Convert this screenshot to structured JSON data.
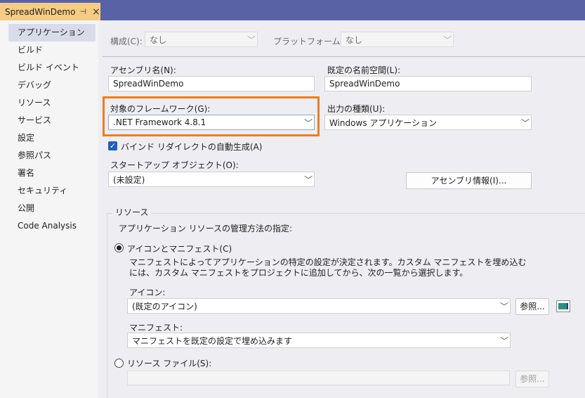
{
  "tab": {
    "title": "SpreadWinDemo",
    "pin": "⊣",
    "close": "×"
  },
  "sidebar": {
    "items": [
      {
        "label": "アプリケーション"
      },
      {
        "label": "ビルド"
      },
      {
        "label": "ビルド イベント"
      },
      {
        "label": "デバッグ"
      },
      {
        "label": "リソース"
      },
      {
        "label": "サービス"
      },
      {
        "label": "設定"
      },
      {
        "label": "参照パス"
      },
      {
        "label": "署名"
      },
      {
        "label": "セキュリティ"
      },
      {
        "label": "公開"
      },
      {
        "label": "Code Analysis"
      }
    ]
  },
  "config": {
    "label": "構成(C):",
    "value": "なし",
    "platform_label": "プラットフォーム(M):",
    "platform_value": "なし"
  },
  "assembly": {
    "label": "アセンブリ名(N):",
    "value": "SpreadWinDemo"
  },
  "namespace": {
    "label": "既定の名前空間(L):",
    "value": "SpreadWinDemo"
  },
  "framework": {
    "label": "対象のフレームワーク(G):",
    "value": ".NET Framework 4.8.1"
  },
  "output": {
    "label": "出力の種類(U):",
    "value": "Windows アプリケーション"
  },
  "binding": {
    "check": "✓",
    "label": "バインド リダイレクトの自動生成(A)"
  },
  "startup": {
    "label": "スタートアップ オブジェクト(O):",
    "value": "(未設定)"
  },
  "assembly_info_button": "アセンブリ情報(I)...",
  "resources": {
    "title": "リソース",
    "instruction": "アプリケーション リソースの管理方法の指定:",
    "icon_manifest_label": "アイコンとマニフェスト(C)",
    "description": "マニフェストによってアプリケーションの特定の設定が決定されます。カスタム マニフェストを埋め込むには、カスタム マニフェストをプロジェクトに追加してから、次の一覧から選択します。",
    "icon_label": "アイコン:",
    "icon_value": "(既定のアイコン)",
    "browse": "参照...",
    "manifest_label": "マニフェスト:",
    "manifest_value": "マニフェストを既定の設定で埋め込みます",
    "resource_file_label": "リソース ファイル(S):",
    "resource_file_value": "",
    "browse2": "参照..."
  },
  "icons": {
    "chevron": "﹀",
    "preview": "app-icon-preview"
  },
  "colors": {
    "accent": "#f07d1a",
    "tabstrip": "#5a62a6",
    "active_tab": "#f5cc84",
    "checkbox": "#1f5fb8"
  }
}
